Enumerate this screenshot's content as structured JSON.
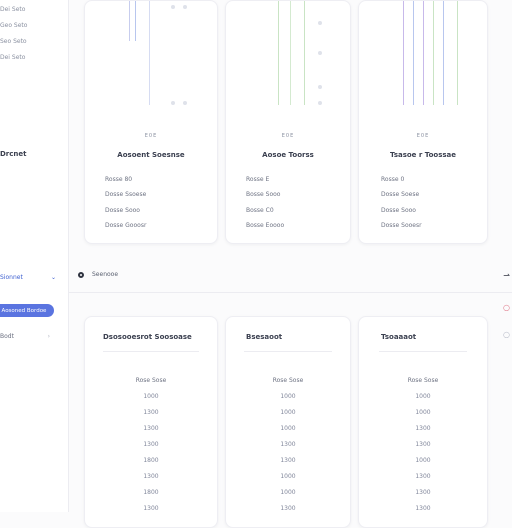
{
  "colors": {
    "accent": "#5a74e0",
    "accent_text": "#3d5fd0",
    "bar_blue": "#b8c6ee",
    "bar_green": "#c9e4c4",
    "bar_purple": "#c7b9ea"
  },
  "sidebar": {
    "links": [
      "Dei Seto",
      "Geo Seto",
      "Seo Seto",
      "Dei Seto"
    ],
    "title": "Drcnet",
    "select_label": "Sionnet",
    "pill_label": "Aosoned Bordoe",
    "option_label": "Bodt"
  },
  "top_cards": [
    {
      "caption": "E0E",
      "title": "Aosoent Soesnse",
      "rows": [
        [
          "Rosse",
          "80"
        ],
        [
          "Dosse",
          "Ssoese"
        ],
        [
          "Dosse",
          "Sooo"
        ],
        [
          "Dosse",
          "Gooosr"
        ]
      ]
    },
    {
      "caption": "E0E",
      "title": "Aosoe Toorss",
      "rows": [
        [
          "Rosse",
          "E"
        ],
        [
          "Bosse",
          "Sooo"
        ],
        [
          "Bosse",
          "C0"
        ],
        [
          "Bosse",
          "Eoooo"
        ]
      ]
    },
    {
      "caption": "E0E",
      "title": "Tsasoe r Toossae",
      "rows": [
        [
          "Rosse",
          "0"
        ],
        [
          "Dosse",
          "Soese"
        ],
        [
          "Dosse",
          "Sooo"
        ],
        [
          "Dosse",
          "Sooesr"
        ]
      ]
    }
  ],
  "filter": {
    "label": "Seenooe"
  },
  "bottom_cards": [
    {
      "title": "Dsosooesrot Soosoase",
      "column": "Rose Sose",
      "cells": [
        "1000",
        "1300",
        "1300",
        "1300",
        "1800",
        "1300",
        "1800",
        "1300"
      ]
    },
    {
      "title": "Bsesaoot",
      "column": "Rose Sose",
      "cells": [
        "1000",
        "1000",
        "1000",
        "1300",
        "1300",
        "1000",
        "1000",
        "1300"
      ]
    },
    {
      "title": "Tsoaaaot",
      "column": "Rose Sose",
      "cells": [
        "1000",
        "1000",
        "1300",
        "1300",
        "1000",
        "1300",
        "1300",
        "1300"
      ]
    }
  ]
}
